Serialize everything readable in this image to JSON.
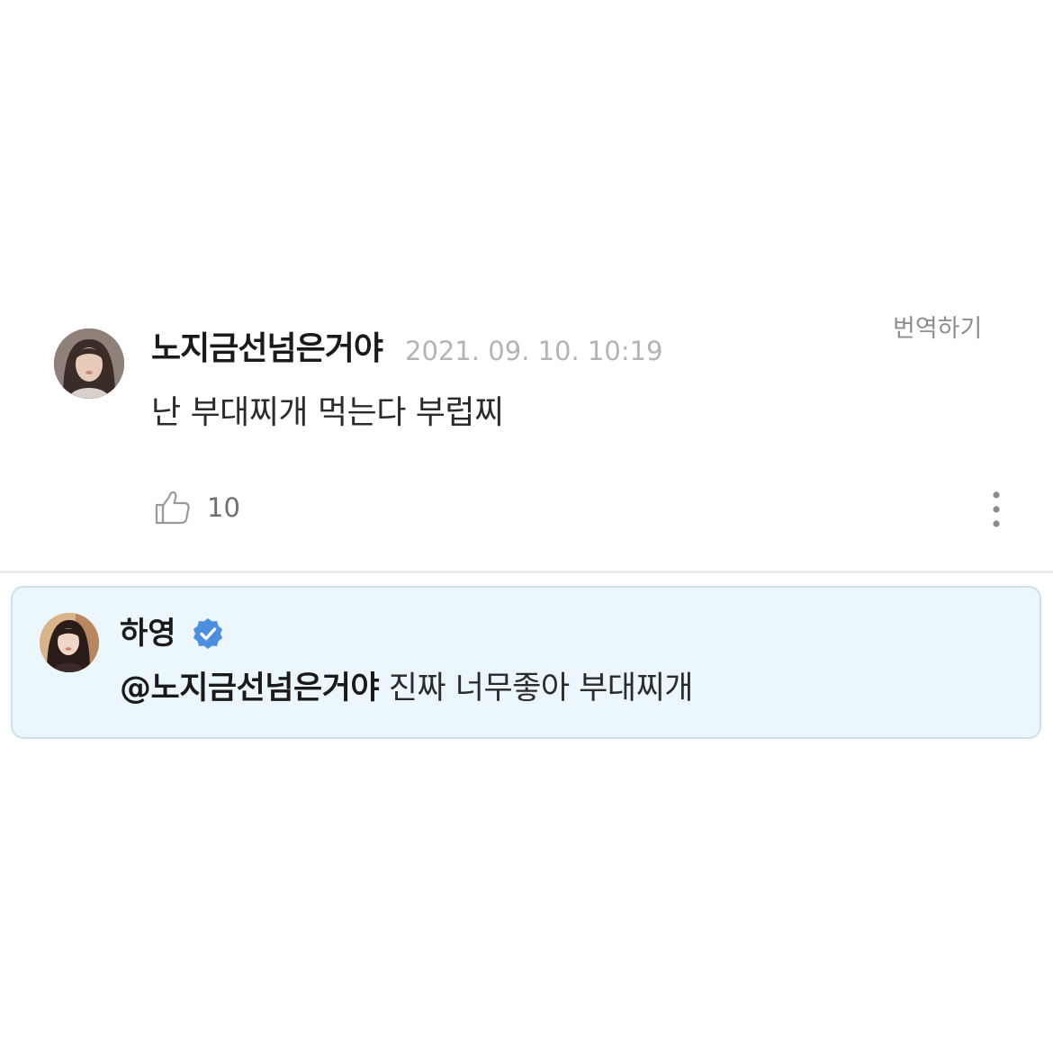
{
  "comment": {
    "author": "노지금선넘은거야",
    "date": "2021. 09. 10. 10:19",
    "translate_label": "번역하기",
    "text": "난 부대찌개 먹는다 부럽찌",
    "like_count": "10",
    "like_icon": "thumbs-up-icon",
    "more_icon": "more-vertical-icon"
  },
  "reply": {
    "author": "하영",
    "verified_icon": "verified-badge-icon",
    "mention": "@노지금선넘은거야",
    "text": " 진짜 너무좋아 부대찌개",
    "colors": {
      "card_background": "#ecf6fd",
      "card_border": "#cfe0ea",
      "verified_badge": "#4a8fe0"
    }
  }
}
